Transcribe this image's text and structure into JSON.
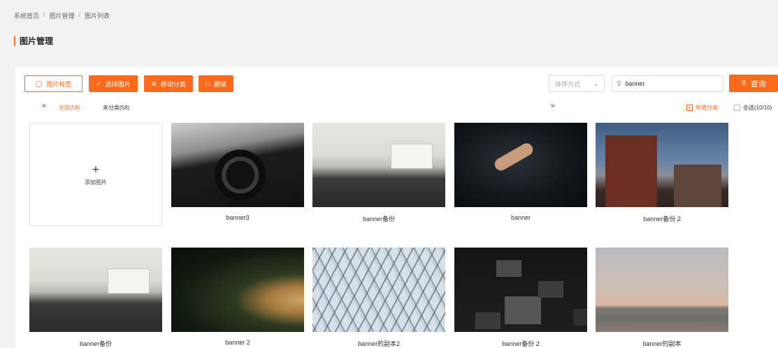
{
  "breadcrumb": {
    "items": [
      "系统首页",
      "图片管理",
      "图片列表"
    ],
    "separator": "/"
  },
  "page": {
    "title": "图片管理"
  },
  "toolbar": {
    "tag_label": "图片标签",
    "select_label": "选择图片",
    "move_label": "移动分类",
    "delete_label": "删除"
  },
  "filters": {
    "sort_placeholder": "排序方式",
    "search_value": "banner",
    "query_label": "查询"
  },
  "tabs": {
    "all_label": "全部(58)",
    "uncategorized_label": "未分类(58)",
    "add_category_label": "新增分类",
    "select_all_label": "全选(10/10)"
  },
  "add_card": {
    "label": "添加图片"
  },
  "images": [
    {
      "caption": "banner3"
    },
    {
      "caption": "banner备份"
    },
    {
      "caption": "banner"
    },
    {
      "caption": "banner备份 2"
    },
    {
      "caption": "banner备份"
    },
    {
      "caption": "banner 2"
    },
    {
      "caption": "banner的副本2"
    },
    {
      "caption": "banner备份 2"
    },
    {
      "caption": "banner的副本"
    }
  ],
  "colors": {
    "accent": "#ff6a1a"
  },
  "icons": [
    "tag-icon",
    "check-icon",
    "move-icon",
    "trash-icon",
    "chevron-down-icon",
    "search-icon",
    "double-chevron-left-icon",
    "double-chevron-right-icon",
    "plus-icon",
    "add-square-icon",
    "checkbox-icon"
  ]
}
